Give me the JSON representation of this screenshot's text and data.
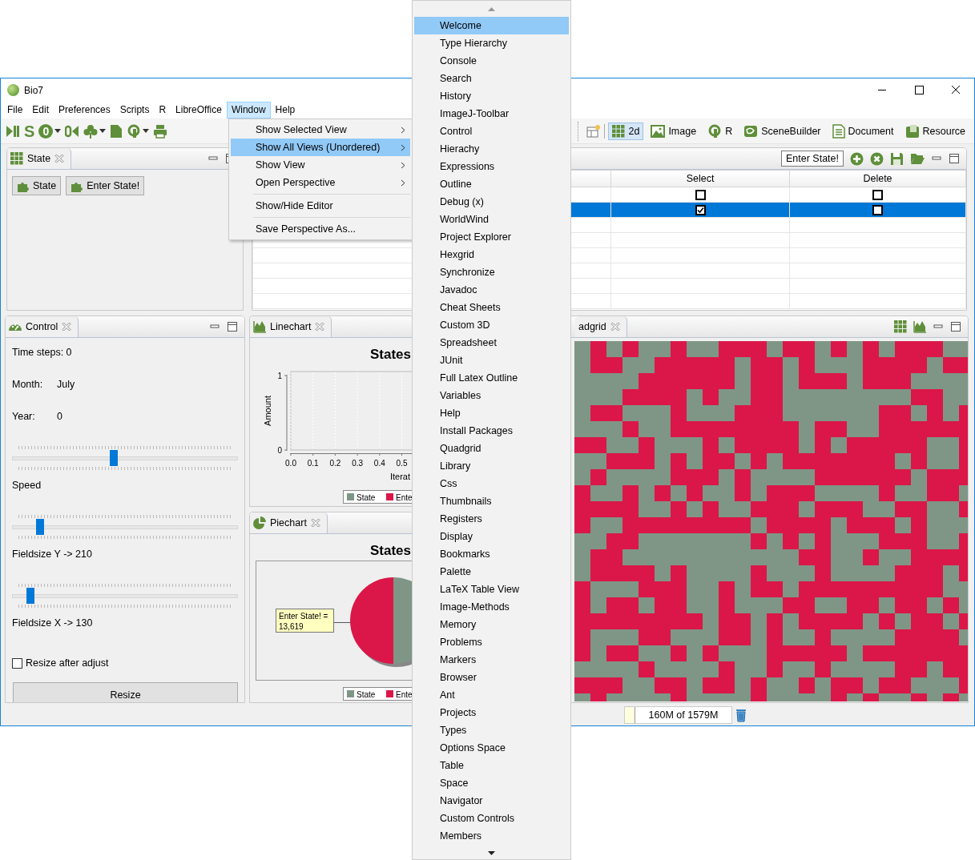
{
  "window": {
    "title": "Bio7"
  },
  "menubar": [
    {
      "label": "File",
      "selected": false
    },
    {
      "label": "Edit",
      "selected": false
    },
    {
      "label": "Preferences",
      "selected": false
    },
    {
      "label": "Scripts",
      "selected": false
    },
    {
      "label": "R",
      "selected": false
    },
    {
      "label": "LibreOffice",
      "selected": false
    },
    {
      "label": "Window",
      "selected": true
    },
    {
      "label": "Help",
      "selected": false
    }
  ],
  "toolbar": {
    "tools": [
      {
        "kind": "play-pause",
        "dropdown": false
      },
      {
        "kind": "letter",
        "text": "S",
        "dropdown": false
      },
      {
        "kind": "disc",
        "text": "0",
        "dropdown": true
      },
      {
        "kind": "rewind",
        "dropdown": false
      },
      {
        "kind": "clover",
        "dropdown": true
      },
      {
        "kind": "page",
        "dropdown": false
      },
      {
        "kind": "ring",
        "dropdown": true
      },
      {
        "kind": "print",
        "dropdown": false
      }
    ],
    "perspectives": [
      {
        "kind": "grid",
        "label": "2d",
        "selected": true
      },
      {
        "kind": "image",
        "label": "Image",
        "selected": false
      },
      {
        "kind": "ring",
        "label": "R",
        "selected": false
      },
      {
        "kind": "scene",
        "label": "SceneBuilder",
        "selected": false
      },
      {
        "kind": "document",
        "label": "Document",
        "selected": false
      },
      {
        "kind": "resource",
        "label": "Resource",
        "selected": false
      }
    ]
  },
  "state_view": {
    "tab": "State",
    "buttons": [
      "State",
      "Enter State!"
    ]
  },
  "table_view": {
    "state_field": {
      "value": "Enter State!"
    },
    "columns": [
      "Select",
      "Delete"
    ],
    "rows": [
      {
        "select": false,
        "delete": false,
        "selected": false
      },
      {
        "select": true,
        "delete": false,
        "selected": true
      }
    ]
  },
  "control_view": {
    "tab": "Control",
    "items": [
      {
        "kind": "text",
        "text": "Time steps: 0"
      },
      {
        "kind": "field",
        "label": "Month:",
        "value": "July"
      },
      {
        "kind": "field",
        "label": "Year:",
        "value": "0"
      },
      {
        "kind": "slider",
        "level": 0.45
      },
      {
        "kind": "text",
        "text": "Speed"
      },
      {
        "kind": "slider",
        "level": 0.12
      },
      {
        "kind": "text",
        "text": "Fieldsize Y -> 210"
      },
      {
        "kind": "slider",
        "level": 0.08
      },
      {
        "kind": "text",
        "text": "Fieldsize X -> 130"
      },
      {
        "kind": "checkbox",
        "label": "Resize after adjust",
        "checked": false
      },
      {
        "kind": "button",
        "label": "Resize"
      }
    ]
  },
  "linechart_view": {
    "tab": "Linechart",
    "title": "States",
    "xlabel": "Iterat",
    "ylabel": "Amount",
    "yticks": [
      "1",
      "0"
    ],
    "xticks": [
      "0.0",
      "0.1",
      "0.2",
      "0.3",
      "0.4",
      "0.5"
    ],
    "legend": [
      {
        "name": "State",
        "color": "#7f9686"
      },
      {
        "name": "Ente",
        "color": "#da1748"
      }
    ]
  },
  "piechart_view": {
    "tab": "Piechart",
    "title": "States",
    "tooltip": [
      "Enter State! =",
      "13,619"
    ],
    "legend": [
      {
        "name": "State",
        "color": "#7f9686"
      },
      {
        "name": "Ente",
        "color": "#da1748"
      }
    ]
  },
  "quadgrid_view": {
    "tab": "adgrid"
  },
  "status_bar": {
    "heap": "160M of 1579M"
  },
  "window_menu": {
    "items": [
      {
        "kind": "item",
        "label": "Show Selected View",
        "submenu": true,
        "selected": false
      },
      {
        "kind": "item",
        "label": "Show All Views (Unordered)",
        "submenu": true,
        "selected": true
      },
      {
        "kind": "item",
        "label": "Show View",
        "submenu": true,
        "selected": false
      },
      {
        "kind": "item",
        "label": "Open Perspective",
        "submenu": true,
        "selected": false
      },
      {
        "kind": "separator"
      },
      {
        "kind": "item",
        "label": "Show/Hide Editor",
        "submenu": false,
        "selected": false
      },
      {
        "kind": "separator"
      },
      {
        "kind": "item",
        "label": "Save Perspective As...",
        "submenu": false,
        "selected": false
      }
    ]
  },
  "views_menu": {
    "items": [
      {
        "label": "Welcome",
        "selected": true
      },
      {
        "label": "Type Hierarchy",
        "selected": false
      },
      {
        "label": "Console",
        "selected": false
      },
      {
        "label": "Search",
        "selected": false
      },
      {
        "label": "History",
        "selected": false
      },
      {
        "label": "ImageJ-Toolbar",
        "selected": false
      },
      {
        "label": "Control",
        "selected": false
      },
      {
        "label": "Hierachy",
        "selected": false
      },
      {
        "label": "Expressions",
        "selected": false
      },
      {
        "label": "Outline",
        "selected": false
      },
      {
        "label": "Debug (x)",
        "selected": false
      },
      {
        "label": "WorldWind",
        "selected": false
      },
      {
        "label": "Project Explorer",
        "selected": false
      },
      {
        "label": "Hexgrid",
        "selected": false
      },
      {
        "label": "Synchronize",
        "selected": false
      },
      {
        "label": "Javadoc",
        "selected": false
      },
      {
        "label": "Cheat Sheets",
        "selected": false
      },
      {
        "label": "Custom 3D",
        "selected": false
      },
      {
        "label": "Spreadsheet",
        "selected": false
      },
      {
        "label": "JUnit",
        "selected": false
      },
      {
        "label": "Full Latex Outline",
        "selected": false
      },
      {
        "label": "Variables",
        "selected": false
      },
      {
        "label": "Help",
        "selected": false
      },
      {
        "label": "Install Packages",
        "selected": false
      },
      {
        "label": "Quadgrid",
        "selected": false
      },
      {
        "label": "Library",
        "selected": false
      },
      {
        "label": "Css",
        "selected": false
      },
      {
        "label": "Thumbnails",
        "selected": false
      },
      {
        "label": "Registers",
        "selected": false
      },
      {
        "label": "Display",
        "selected": false
      },
      {
        "label": "Bookmarks",
        "selected": false
      },
      {
        "label": "Palette",
        "selected": false
      },
      {
        "label": "LaTeX Table View",
        "selected": false
      },
      {
        "label": "Image-Methods",
        "selected": false
      },
      {
        "label": "Memory",
        "selected": false
      },
      {
        "label": "Problems",
        "selected": false
      },
      {
        "label": "Markers",
        "selected": false
      },
      {
        "label": "Browser",
        "selected": false
      },
      {
        "label": "Ant",
        "selected": false
      },
      {
        "label": "Projects",
        "selected": false
      },
      {
        "label": "Types",
        "selected": false
      },
      {
        "label": "Options Space",
        "selected": false
      },
      {
        "label": "Table",
        "selected": false
      },
      {
        "label": "Space",
        "selected": false
      },
      {
        "label": "Navigator",
        "selected": false
      },
      {
        "label": "Custom Controls",
        "selected": false
      },
      {
        "label": "Members",
        "selected": false
      }
    ]
  }
}
